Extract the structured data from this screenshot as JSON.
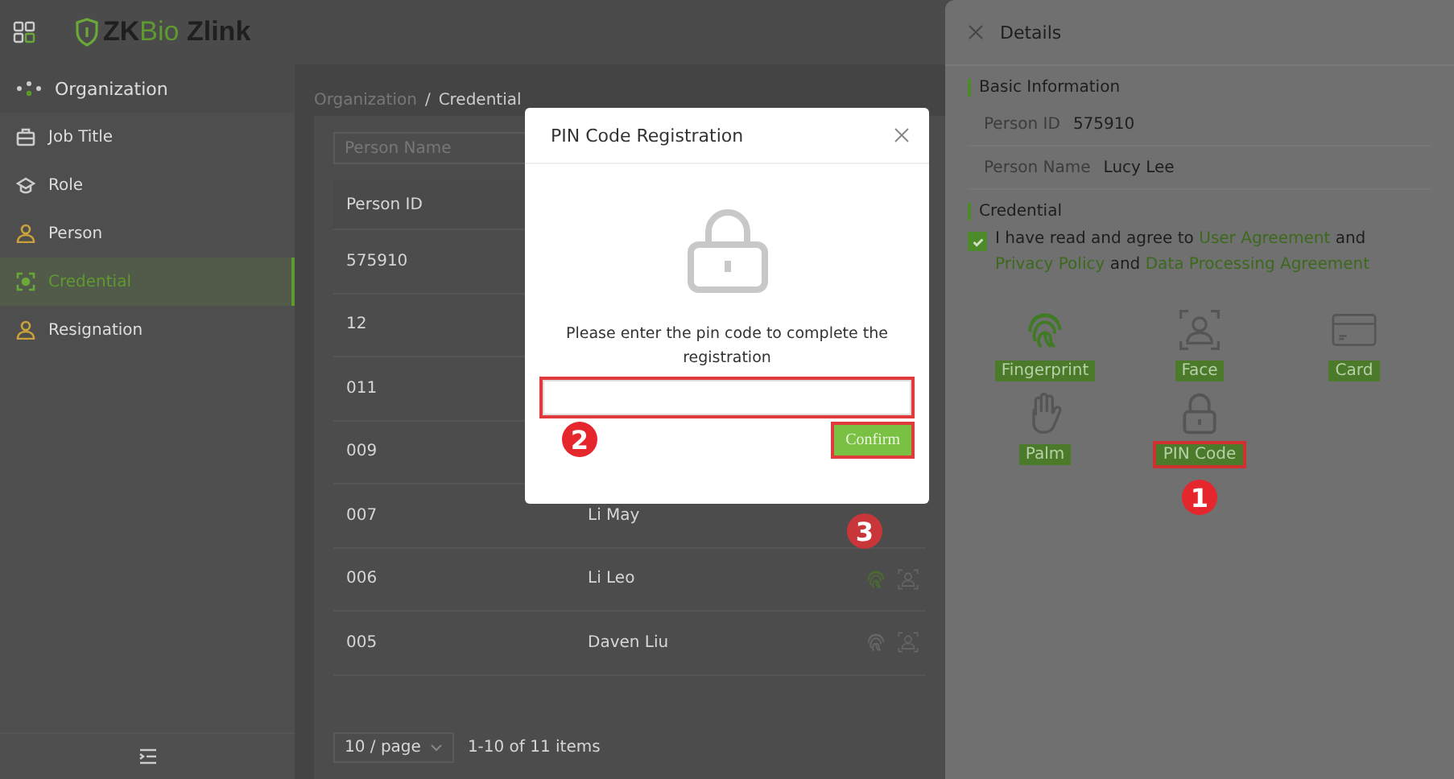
{
  "logo": [
    {
      "text": "ZK",
      "accent": false
    },
    {
      "text": "Bio",
      "accent": true
    },
    {
      "text": " Zlink",
      "accent": false
    }
  ],
  "sidebar": {
    "items": [
      {
        "label": "Organization",
        "kind": "group",
        "selected": false
      },
      {
        "label": "Job Title",
        "kind": "briefcase",
        "selected": false
      },
      {
        "label": "Role",
        "kind": "cap",
        "selected": false
      },
      {
        "label": "Person",
        "kind": "person",
        "selected": false
      },
      {
        "label": "Credential",
        "kind": "scan",
        "selected": true
      },
      {
        "label": "Resignation",
        "kind": "person",
        "selected": false
      }
    ]
  },
  "breadcrumb": {
    "items": [
      "Organization",
      "Credential"
    ],
    "separator": "/"
  },
  "search": {
    "placeholder": "Person Name"
  },
  "table": {
    "columns": [
      "Person ID"
    ],
    "rows": [
      {
        "person_id": "575910"
      },
      {
        "person_id": "12"
      },
      {
        "person_id": "011"
      },
      {
        "person_id": "009"
      },
      {
        "person_id": "007",
        "person_name": "Li May"
      },
      {
        "person_id": "006",
        "person_name": "Li Leo",
        "fingerprint_registered": true
      },
      {
        "person_id": "005",
        "person_name": "Daven Liu",
        "fingerprint_registered": false
      }
    ]
  },
  "pagination": {
    "page_size": "10 / page",
    "range": "1-10 of 11 items"
  },
  "modal": {
    "title": "PIN Code Registration",
    "message": "Please enter the pin code to complete the registration",
    "input_highlighted": true,
    "input_callout": "2",
    "confirm": {
      "label": "Confirm",
      "highlighted": true,
      "callout": "3"
    }
  },
  "drawer": {
    "title": "Details",
    "basic_section": "Basic Information",
    "fields": [
      {
        "label": "Person ID",
        "value": "575910"
      },
      {
        "label": "Person Name",
        "value": "Lucy Lee"
      }
    ],
    "credential_section": "Credential",
    "agreement": {
      "checked": true,
      "parts": [
        {
          "text": "I have read and agree to",
          "link": false
        },
        {
          "text": "User Agreement",
          "link": true
        },
        {
          "text": "and",
          "link": false
        },
        {
          "text": "Privacy Policy",
          "link": true
        },
        {
          "text": "and",
          "link": false
        },
        {
          "text": "Data Processing Agreement",
          "link": true
        }
      ]
    },
    "options": [
      {
        "label": "Fingerprint",
        "kind": "fingerprint",
        "registered": true,
        "highlighted": false
      },
      {
        "label": "Face",
        "kind": "face",
        "registered": false,
        "highlighted": false
      },
      {
        "label": "Card",
        "kind": "card",
        "registered": false,
        "highlighted": false
      },
      {
        "label": "Palm",
        "kind": "palm",
        "registered": false,
        "highlighted": false
      },
      {
        "label": "PIN Code",
        "kind": "pin",
        "registered": false,
        "highlighted": true,
        "callout": "1"
      }
    ]
  }
}
